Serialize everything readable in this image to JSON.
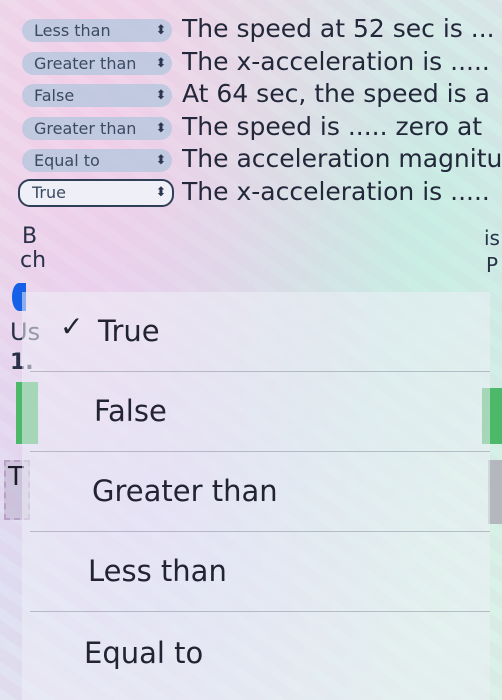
{
  "rows": [
    {
      "select": "Less than",
      "statement": "The speed at 52 sec is ..."
    },
    {
      "select": "Greater than",
      "statement": "The x-acceleration is ....."
    },
    {
      "select": "False",
      "statement": "At 64 sec, the speed is a"
    },
    {
      "select": "Greater than",
      "statement": "The speed is ..... zero at"
    },
    {
      "select": "Equal to",
      "statement": "The acceleration magnitu"
    },
    {
      "select": "True",
      "statement": "The x-acceleration is ....."
    }
  ],
  "picker": {
    "selected_index": 0,
    "check_glyph": "✓",
    "options": [
      "True",
      "False",
      "Greater than",
      "Less than",
      "Equal to"
    ]
  },
  "background_fragments": {
    "b_frag": "B",
    "ch_frag": "ch",
    "us_frag": "Us",
    "num_frag": "1.",
    "t_frag": "T",
    "is_frag": "is",
    "p_frag": "P"
  },
  "icons": {
    "chevron": "up-down-chevron-icon"
  },
  "colors": {
    "select_bg": "#b9c8de",
    "active_border": "#2f3f58",
    "accent_blue": "#1560e6",
    "green": "#4cb86a"
  }
}
